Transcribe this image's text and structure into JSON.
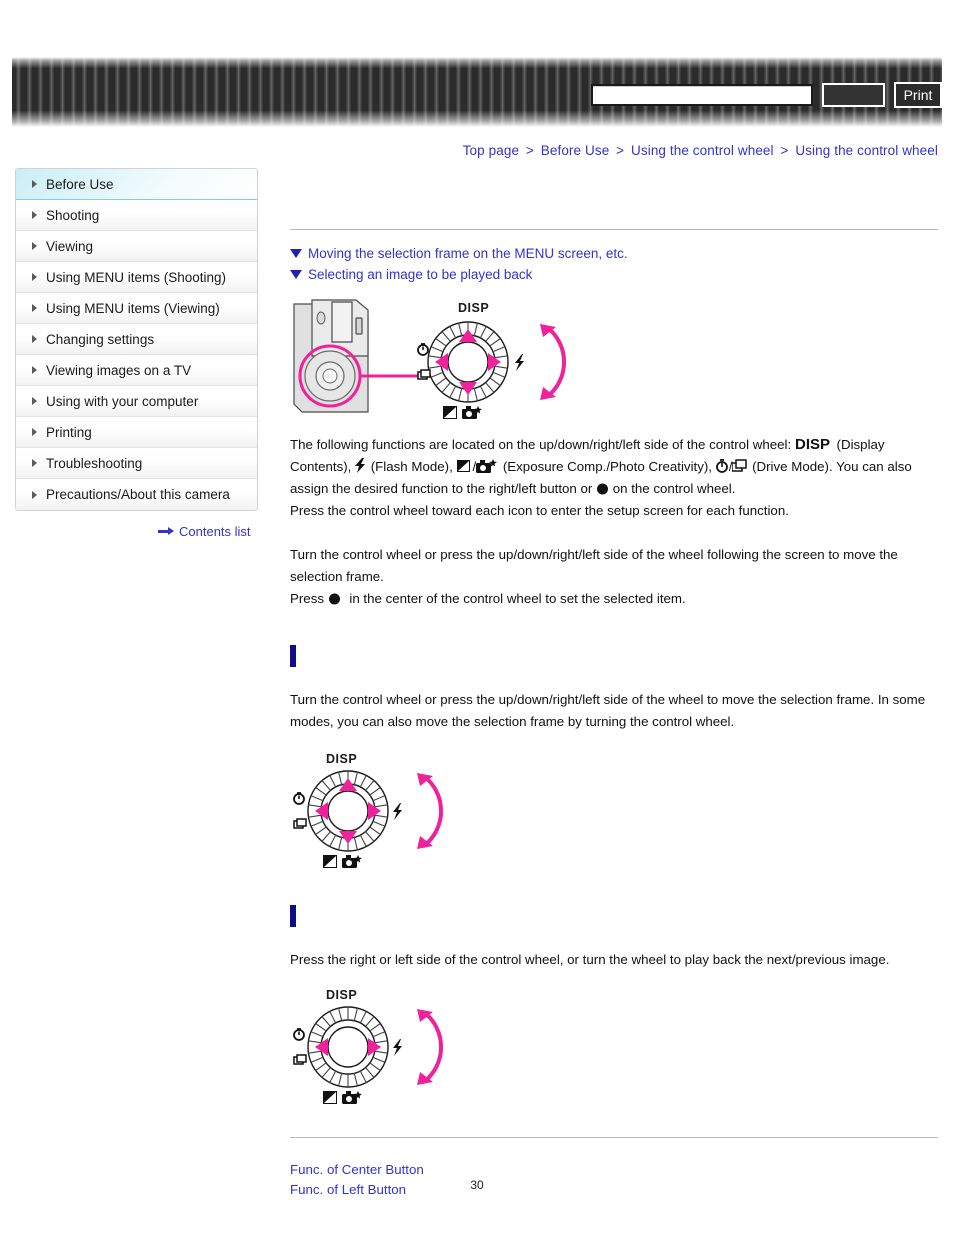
{
  "header": {
    "search_value": "",
    "search_placeholder": "",
    "search_button_label": "",
    "print_button_label": "Print"
  },
  "breadcrumb": {
    "items": [
      "Top page",
      "Before Use",
      "Using the control wheel",
      "Using the control wheel"
    ],
    "separator": ">"
  },
  "sidebar": {
    "items": [
      {
        "label": "Before Use",
        "active": true
      },
      {
        "label": "Shooting",
        "active": false
      },
      {
        "label": "Viewing",
        "active": false
      },
      {
        "label": "Using MENU items (Shooting)",
        "active": false
      },
      {
        "label": "Using MENU items (Viewing)",
        "active": false
      },
      {
        "label": "Changing settings",
        "active": false
      },
      {
        "label": "Viewing images on a TV",
        "active": false
      },
      {
        "label": "Using with your computer",
        "active": false
      },
      {
        "label": "Printing",
        "active": false
      },
      {
        "label": "Troubleshooting",
        "active": false
      },
      {
        "label": "Precautions/About this camera",
        "active": false
      }
    ],
    "contents_list_label": "Contents list"
  },
  "main": {
    "anchor_links": [
      "Moving the selection frame on the MENU screen, etc.",
      "Selecting an image to be played back"
    ],
    "intro_paragraph_1_a": "The following functions are located on the up/down/right/left side of the control wheel: ",
    "intro_glyph_disp": "DISP",
    "intro_paragraph_1_b": " (Display Contents), ",
    "intro_glyph_flash": "⚡",
    "intro_paragraph_1_c": " (Flash Mode), ",
    "intro_glyph_expcomp": "◢",
    "intro_glyph_creativity": "◗",
    "intro_paragraph_1_d": " (Exposure Comp./Photo Creativity), ",
    "intro_glyph_selftimer": "⏱",
    "intro_glyph_drive": "❐",
    "intro_paragraph_1_e": " (Drive Mode). You can also assign the desired function to the right/left button or ",
    "intro_glyph_center": "●",
    "intro_paragraph_1_f": " on the control wheel.",
    "intro_paragraph_2": "Press the control wheel toward each icon to enter the setup screen for each function.",
    "intro_paragraph_3": "Turn the control wheel or press the up/down/right/left side of the wheel following the screen to move the selection frame.",
    "intro_paragraph_4_a": "Press ",
    "intro_paragraph_4_b": " in the center of the control wheel to set the selected item.",
    "section_1": {
      "heading": "",
      "paragraph": "Turn the control wheel or press the up/down/right/left side of the wheel to move the selection frame. In some modes, you can also move the selection frame by turning the control wheel."
    },
    "section_2": {
      "heading": "",
      "paragraph": "Press the right or left side of the control wheel, or turn the wheel to play back the next/previous image."
    },
    "footer_links": [
      "Func. of Center Button",
      "Func. of Left Button"
    ],
    "page_number": "30"
  },
  "wheel_labels": {
    "disp": "DISP",
    "flash": "flash",
    "self_timer": "self-timer",
    "drive": "drive",
    "exposure_comp": "exposure-comp",
    "photo_creativity": "photo-creativity"
  },
  "colors": {
    "accent_pink": "#f0219a",
    "link_blue": "#3333cc",
    "heading_blue": "#0d0d8c",
    "active_nav_cyan": "#c9eef6"
  }
}
